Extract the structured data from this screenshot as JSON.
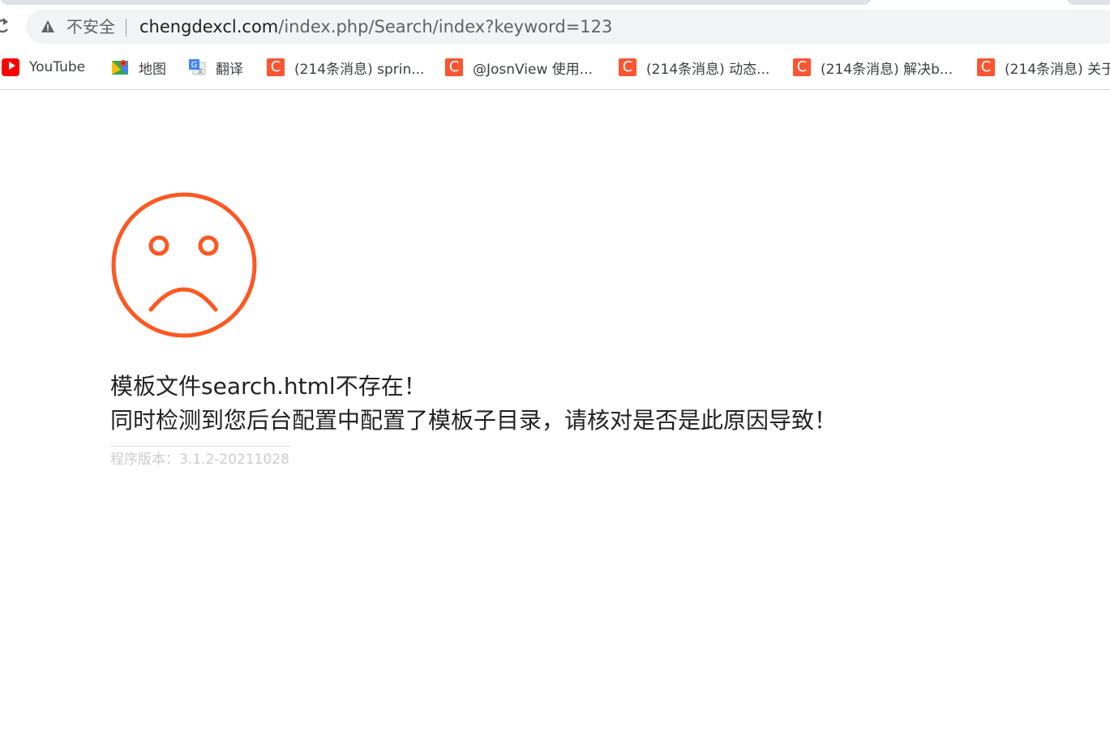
{
  "browser": {
    "security_label": "不安全",
    "url_host": "chengdexcl.com",
    "url_path": "/index.php/Search/index?keyword=123"
  },
  "bookmarks": [
    {
      "label": "YouTube",
      "icon": "youtube-icon"
    },
    {
      "label": "地图",
      "icon": "maps-icon"
    },
    {
      "label": "翻译",
      "icon": "translate-icon"
    },
    {
      "label": "(214条消息) sprin...",
      "icon": "csdn-icon"
    },
    {
      "label": "@JosnView 使用...",
      "icon": "csdn-icon"
    },
    {
      "label": "(214条消息) 动态...",
      "icon": "csdn-icon"
    },
    {
      "label": "(214条消息) 解决b...",
      "icon": "csdn-icon"
    },
    {
      "label": "(214条消息) 关于",
      "icon": "csdn-icon"
    }
  ],
  "error": {
    "icon": "sad-face-icon",
    "color": "#ff5722",
    "line1": "模板文件search.html不存在！",
    "line2": "同时检测到您后台配置中配置了模板子目录，请核对是否是此原因导致！",
    "version": "程序版本：3.1.2-20211028"
  }
}
